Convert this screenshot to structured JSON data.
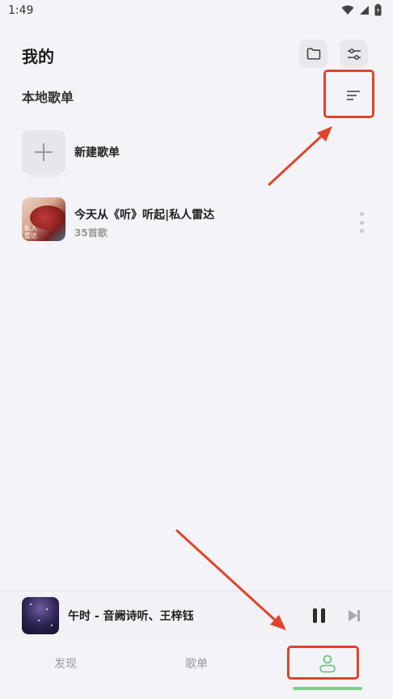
{
  "status": {
    "time": "1:49"
  },
  "header": {
    "title": "我的"
  },
  "section": {
    "title": "本地歌单"
  },
  "new_playlist": {
    "label": "新建歌单"
  },
  "playlists": [
    {
      "name": "今天从《听》听起|私人雷达",
      "count": "35首歌",
      "cover_tag": "私人雷达"
    }
  ],
  "now_playing": {
    "title": "午时 - 音阙诗听、王梓钰"
  },
  "tabs": {
    "discover": "发现",
    "playlists": "歌单",
    "mine": "我的"
  },
  "colors": {
    "accent": "#7fd18d",
    "annotation": "#e1442a",
    "background": "#f4f3f8"
  },
  "icons": [
    "wifi-icon",
    "signal-icon",
    "battery-icon",
    "folder-icon",
    "filter-icon",
    "sort-icon",
    "plus-icon",
    "more-icon",
    "pause-icon",
    "next-icon",
    "user-icon"
  ]
}
